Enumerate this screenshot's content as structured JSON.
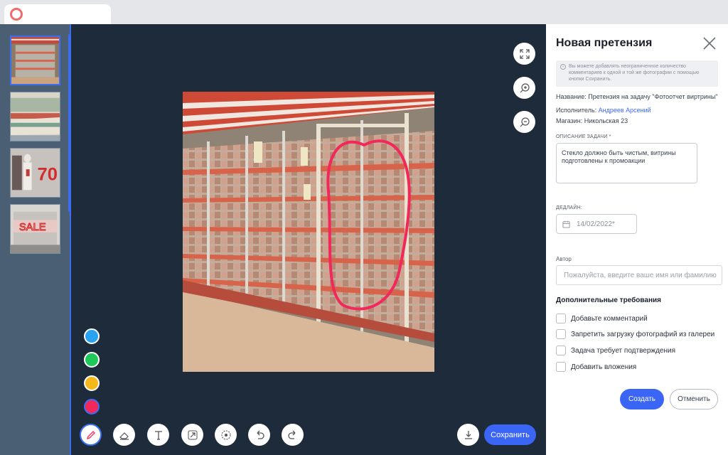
{
  "browser": {
    "tab_icon": "circle-logo-icon",
    "accent": "#f26b6b"
  },
  "thumbnails": [
    {
      "name": "refrigerated-shelves-photo",
      "selected": true
    },
    {
      "name": "deli-counter-photo",
      "selected": false
    },
    {
      "name": "mannequins-70-photo",
      "selected": false,
      "sign_text": "70"
    },
    {
      "name": "sale-window-photo",
      "selected": false,
      "sign_text": "SALE"
    }
  ],
  "editor": {
    "view_tools": [
      "expand-icon",
      "zoom-in-icon",
      "zoom-out-icon"
    ],
    "colors": [
      "#2aa2f2",
      "#1ec95a",
      "#f6b81a",
      "#f2285b"
    ],
    "selected_color": "#f2285b",
    "tools": [
      "pencil-icon",
      "eraser-icon",
      "text-icon",
      "arrow-icon",
      "blur-icon",
      "undo-icon",
      "redo-icon"
    ],
    "active_tool": "pencil-icon",
    "download_icon": "download-icon",
    "save_label": "Сохранить",
    "annotation_color": "#f2285b"
  },
  "panel": {
    "title": "Новая претензия",
    "info": "Вы можете добавлять неограниченное количество комментариев к одной и той же фотографии с помощью кнопки Сохранить.",
    "name_label": "Название:",
    "name_value": "Претензия на задачу \"Фотоотчет виртрины\"",
    "assignee_label": "Исполнитель:",
    "assignee_value": "Андреев Арсений",
    "store_label": "Магазин:",
    "store_value": "Никольская 23",
    "description_label": "ОПИСАНИЕ ЗАДАЧИ *",
    "description_value": "Стекло должно быть чистым, витрины подготовлены к промоакции",
    "deadline_label": "ДЕДЛАЙН:",
    "deadline_value": "14/02/2022*",
    "author_label": "Автор",
    "author_placeholder": "Пожалуйста, введите ваше имя или фамилию",
    "extra_title": "Дополнительные требования",
    "checkboxes": [
      {
        "label": "Добавьте комментарий",
        "checked": false
      },
      {
        "label": "Запретить загрузку фотографий из галереи",
        "checked": false
      },
      {
        "label": "Задача требует подтверждения",
        "checked": false
      },
      {
        "label": "Добавить вложения",
        "checked": false
      }
    ],
    "create_label": "Создать",
    "cancel_label": "Отменить",
    "accent": "#3b66f5"
  }
}
